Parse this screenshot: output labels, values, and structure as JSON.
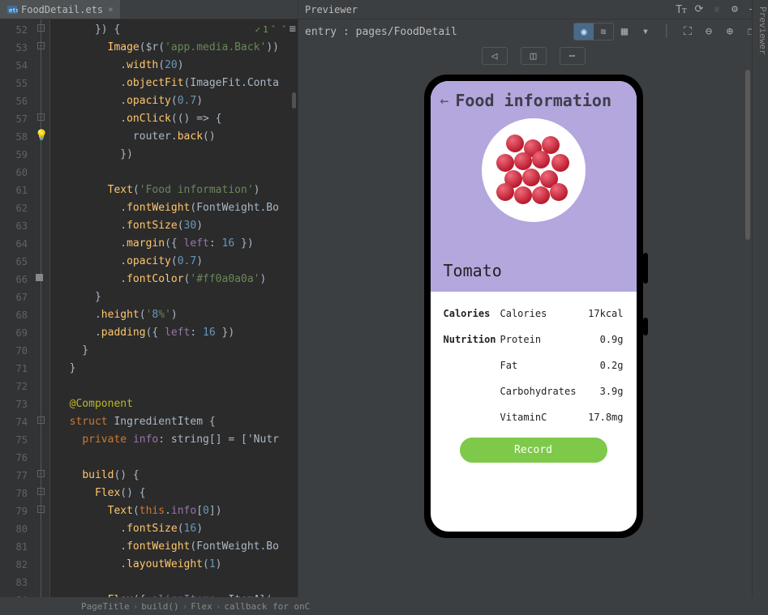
{
  "editor": {
    "tab_name": "FoodDetail.ets",
    "hint_count": "1",
    "line_start": 52,
    "lines": [
      "      }) {",
      "        Image($r('app.media.Back'))",
      "          .width(20)",
      "          .objectFit(ImageFit.Conta",
      "          .opacity(0.7)",
      "          .onClick(() => {",
      "            router.back()",
      "          })",
      "",
      "        Text('Food information')",
      "          .fontWeight(FontWeight.Bo",
      "          .fontSize(30)",
      "          .margin({ left: 16 })",
      "          .opacity(0.7)",
      "          .fontColor('#ff0a0a0a')",
      "      }",
      "      .height('8%')",
      "      .padding({ left: 16 })",
      "    }",
      "  }",
      "",
      "  @Component",
      "  struct IngredientItem {",
      "    private info: string[] = ['Nutr",
      "",
      "    build() {",
      "      Flex() {",
      "        Text(this.info[0])",
      "          .fontSize(16)",
      "          .fontWeight(FontWeight.Bo",
      "          .layoutWeight(1)",
      "",
      "        Flex({ alignItems: ItemAli"
    ],
    "breadcrumbs": [
      "PageTitle",
      "build()",
      "Flex",
      "callback for onC"
    ]
  },
  "previewer": {
    "title": "Previewer",
    "entry_label": "entry : pages/FoodDetail",
    "side_label": "Previewer"
  },
  "app": {
    "title": "Food information",
    "food_name": "Tomato",
    "sections": {
      "calories": {
        "label": "Calories",
        "rows": [
          {
            "name": "Calories",
            "value": "17kcal"
          }
        ]
      },
      "nutrition": {
        "label": "Nutrition",
        "rows": [
          {
            "name": "Protein",
            "value": "0.9g"
          },
          {
            "name": "Fat",
            "value": "0.2g"
          },
          {
            "name": "Carbohydrates",
            "value": "3.9g"
          },
          {
            "name": "VitaminC",
            "value": "17.8mg"
          }
        ]
      }
    },
    "record_label": "Record"
  }
}
